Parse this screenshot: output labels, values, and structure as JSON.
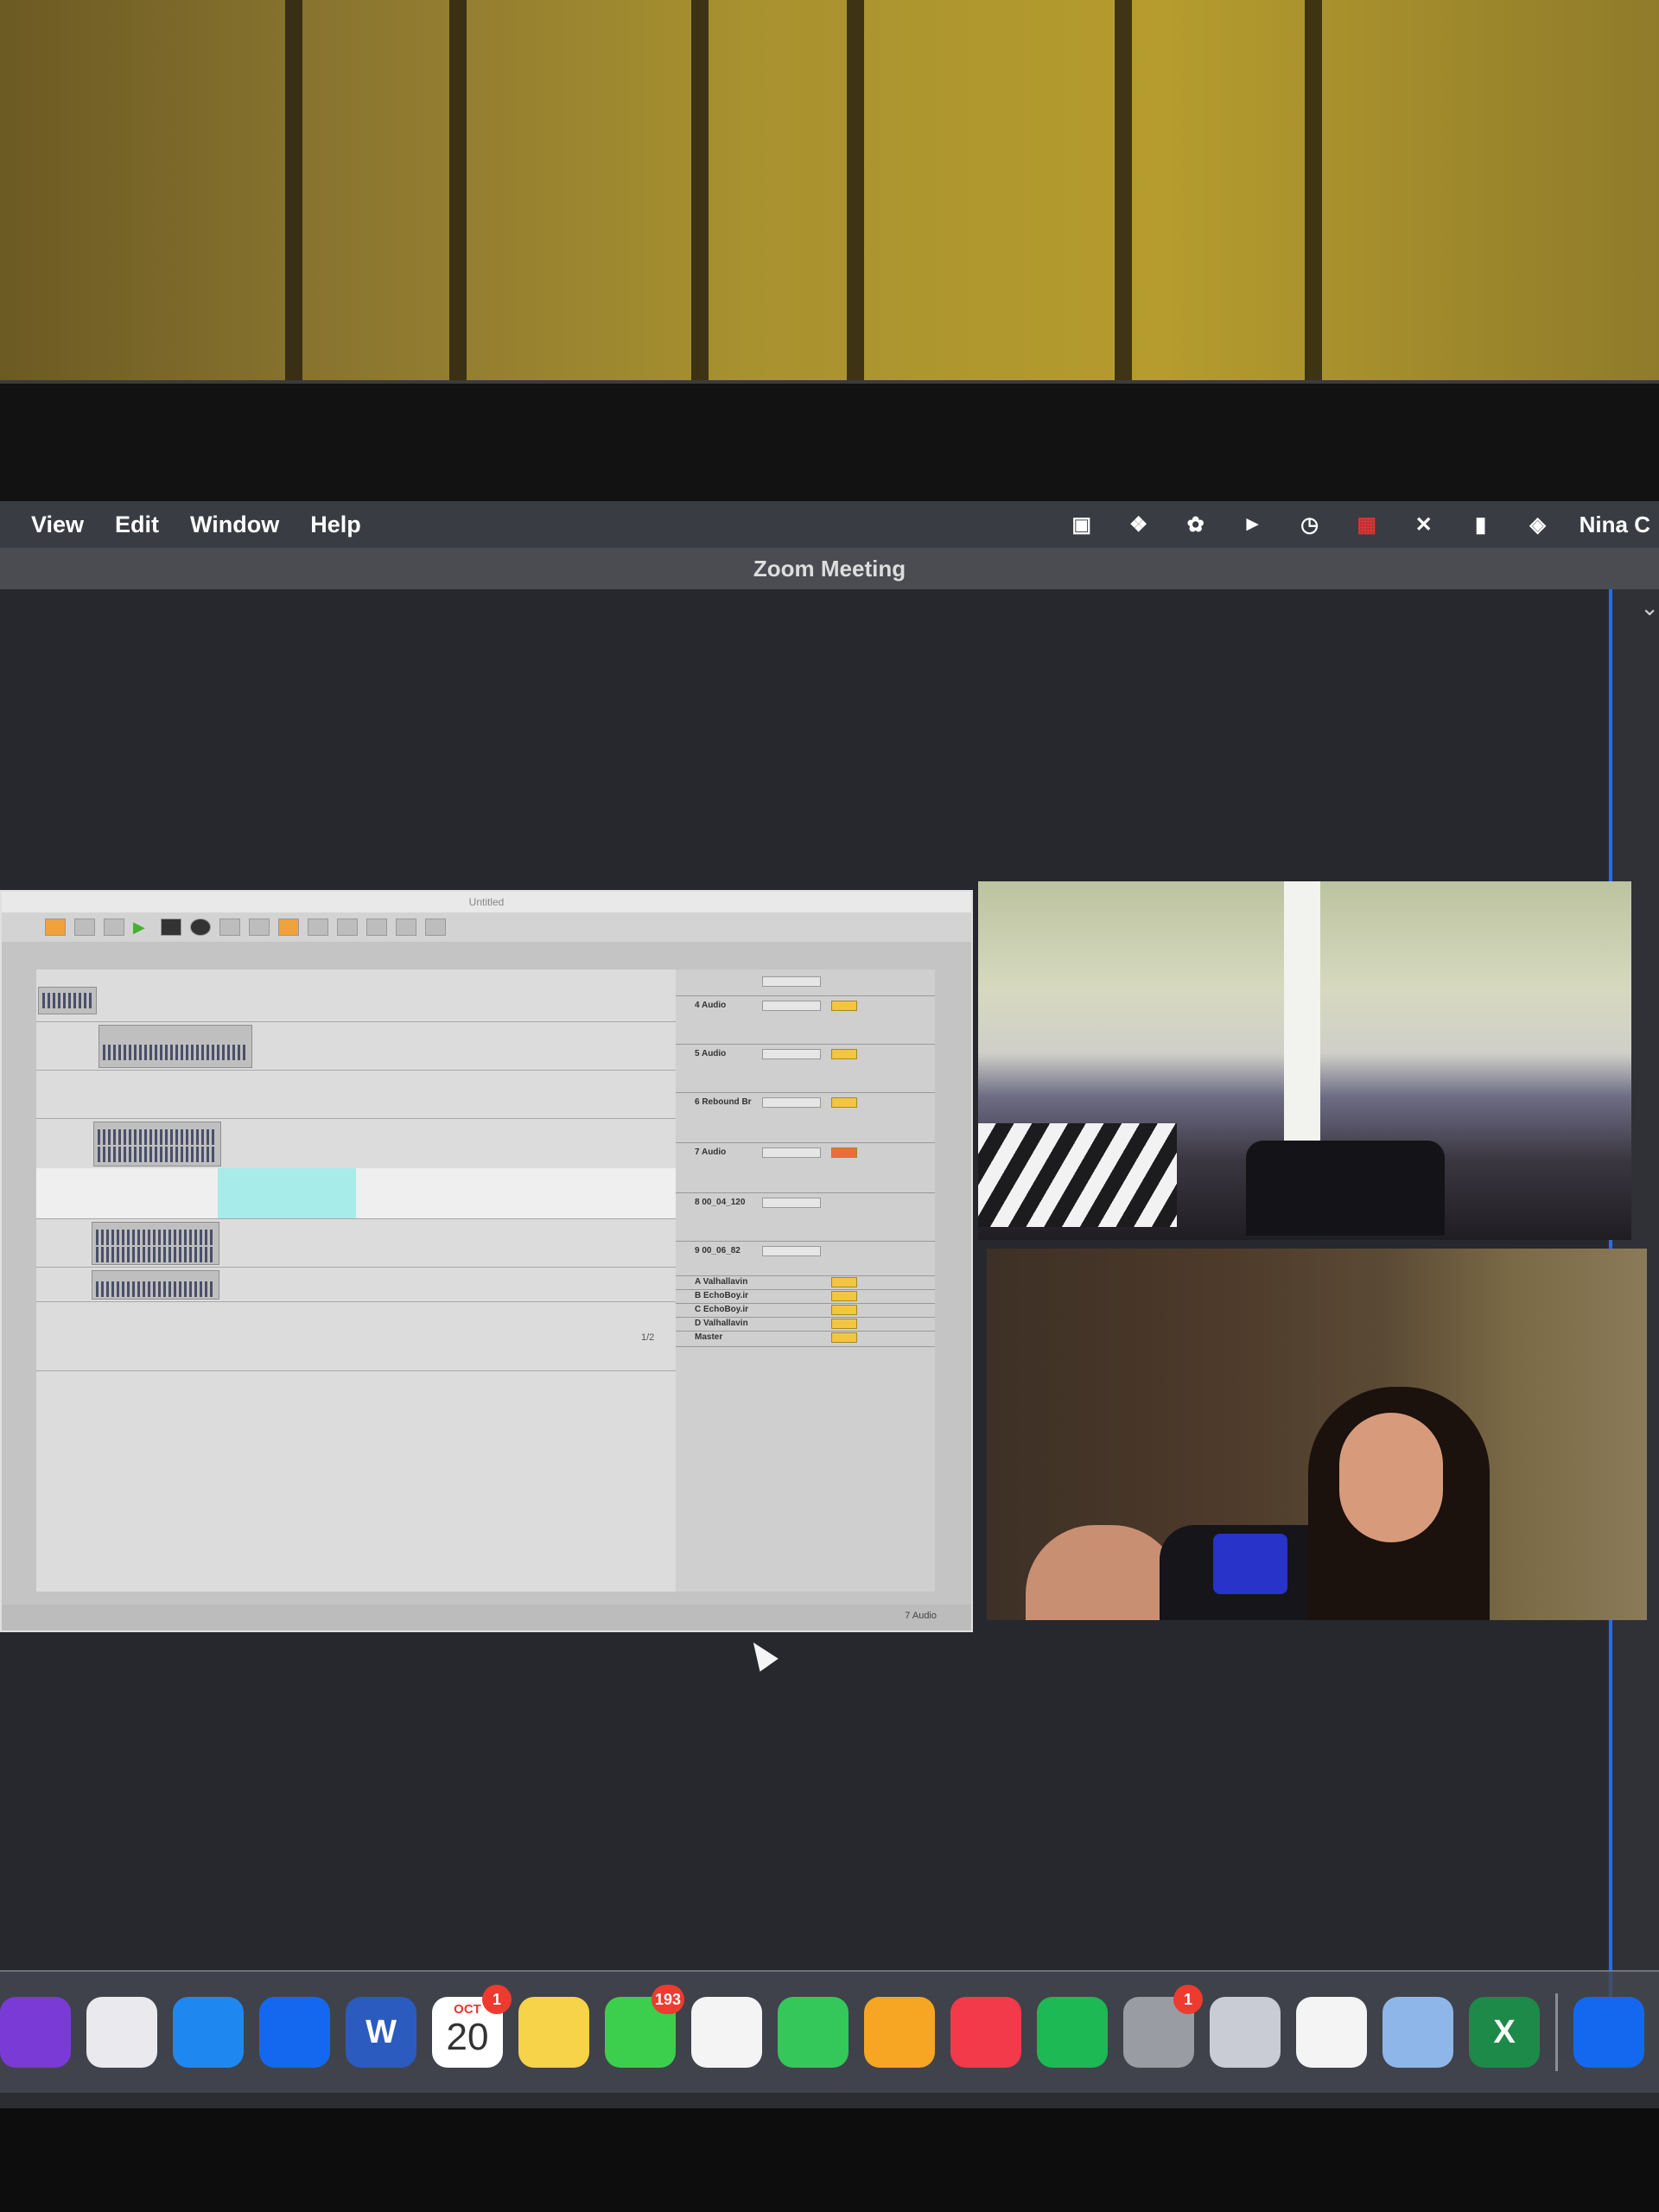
{
  "menubar": {
    "items": [
      "View",
      "Edit",
      "Window",
      "Help"
    ],
    "status_icons": [
      "zoom-icon",
      "dropbox-icon",
      "creative-cloud-icon",
      "play-circle-icon",
      "time-machine-icon",
      "flag-icon",
      "bluetooth-icon",
      "battery-icon",
      "wifi-icon"
    ],
    "user_name": "Nina C"
  },
  "zoom": {
    "window_title": "Zoom Meeting"
  },
  "shared_screen": {
    "app_title": "Untitled",
    "status_label": "7 Audio",
    "tracks": [
      "4 Audio",
      "5 Audio",
      "6 Rebound Br",
      "7 Audio",
      "8 00_04_120",
      "9 00_06_82",
      "A Valhallavin",
      "B EchoBoy.ir",
      "C EchoBoy.ir",
      "D Valhallavin",
      "Master"
    ],
    "page_indicator": "1/2"
  },
  "dock": {
    "apps": [
      {
        "name": "siri-icon",
        "color": "#7a3ad6"
      },
      {
        "name": "launchpad-icon",
        "color": "#e9e9ee"
      },
      {
        "name": "safari-icon",
        "color": "#1f88f0"
      },
      {
        "name": "zoom-app-icon",
        "color": "#1468f0"
      },
      {
        "name": "word-icon",
        "color": "#2b5bbf",
        "label": "W"
      },
      {
        "name": "calendar-icon",
        "color": "#ffffff",
        "month": "OCT",
        "day": "20",
        "badge": "1"
      },
      {
        "name": "notes-icon",
        "color": "#f7d34a"
      },
      {
        "name": "messages-icon",
        "color": "#3ccf4e",
        "badge": "193"
      },
      {
        "name": "photos-icon",
        "color": "#f4f4f4"
      },
      {
        "name": "facetime-icon",
        "color": "#34c759"
      },
      {
        "name": "pages-icon",
        "color": "#f6a623"
      },
      {
        "name": "music-icon",
        "color": "#f23a4b"
      },
      {
        "name": "spotify-icon",
        "color": "#1db954"
      },
      {
        "name": "system-preferences-icon",
        "color": "#9a9ca3",
        "badge": "1"
      },
      {
        "name": "disk-utility-icon",
        "color": "#c9ccd4"
      },
      {
        "name": "chrome-icon",
        "color": "#f4f4f4"
      },
      {
        "name": "preview-icon",
        "color": "#8fb6e8"
      },
      {
        "name": "excel-icon",
        "color": "#1e8a4a",
        "label": "X"
      },
      {
        "name": "zoom-dock-icon",
        "color": "#1468f0"
      }
    ]
  }
}
